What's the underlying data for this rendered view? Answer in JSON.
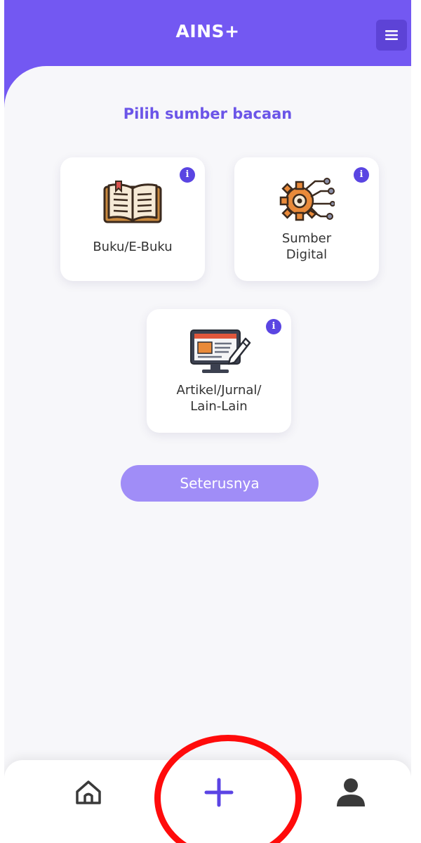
{
  "app": {
    "title": "AINS+"
  },
  "header": {
    "menu_icon": "hamburger-menu-icon"
  },
  "main": {
    "title": "Pilih sumber bacaan",
    "cards": [
      {
        "label": "Buku/E-Buku",
        "icon": "open-book-icon"
      },
      {
        "label_line1": "Sumber",
        "label_line2": "Digital",
        "icon": "digital-gear-network-icon"
      },
      {
        "label_line1": "Artikel/Jurnal/",
        "label_line2": "Lain-Lain",
        "icon": "article-monitor-icon"
      }
    ],
    "info_badge": "i",
    "next_button": "Seterusnya"
  },
  "bottom_nav": {
    "items": [
      {
        "icon": "home-icon"
      },
      {
        "icon": "plus-icon"
      },
      {
        "icon": "user-icon"
      }
    ]
  },
  "colors": {
    "primary": "#7358f2",
    "primary_dark": "#5a45e2",
    "button_light": "#a08df7",
    "background": "#f7f7fa",
    "annotation": "#ff0b0b"
  }
}
